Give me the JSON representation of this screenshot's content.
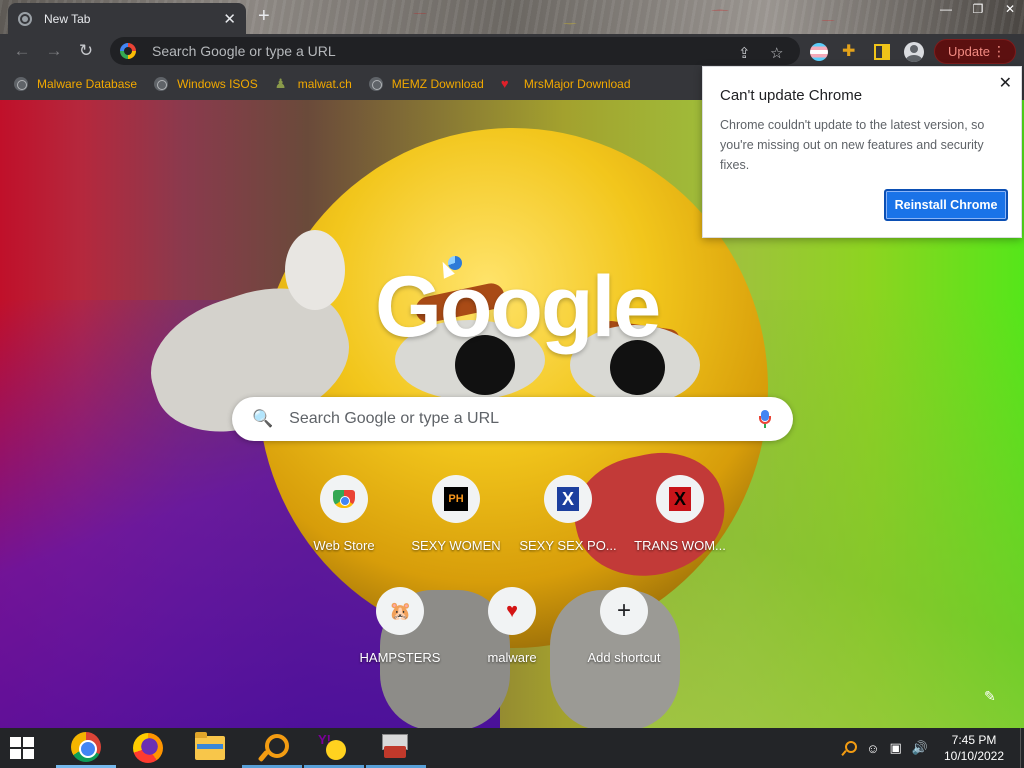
{
  "window": {
    "tab_title": "New Tab",
    "tab_close_glyph": "✕",
    "new_tab_glyph": "+",
    "controls": {
      "minimize": "—",
      "maximize": "❐",
      "close": "✕"
    }
  },
  "toolbar": {
    "back_glyph": "←",
    "forward_glyph": "→",
    "reload_glyph": "↻",
    "omnibox_placeholder": "Search Google or type a URL",
    "share_glyph": "⇪",
    "bookmark_glyph": "☆",
    "puzzle_glyph": "✚",
    "update_label": "Update",
    "menu_glyph": "⋮"
  },
  "bookmarks": [
    {
      "label": "Malware Database",
      "icon": "globe-icon"
    },
    {
      "label": "Windows ISOS",
      "icon": "globe-icon"
    },
    {
      "label": "malwat.ch",
      "icon": "person-icon"
    },
    {
      "label": "MEMZ Download",
      "icon": "globe-icon"
    },
    {
      "label": "MrsMajor Download",
      "icon": "heart-icon"
    }
  ],
  "ntp": {
    "logo_text": "Google",
    "search_placeholder": "Search Google or type a URL",
    "search_glyph": "🔍",
    "tiles": [
      {
        "label": "Web Store",
        "icon": "webstore-icon",
        "text": ""
      },
      {
        "label": "SEXY WOMEN",
        "icon": "ph-icon",
        "text": "PH"
      },
      {
        "label": "SEXY SEX PO...",
        "icon": "xvideos-icon",
        "text": "X"
      },
      {
        "label": "TRANS WOM...",
        "icon": "xvideos-red-icon",
        "text": "X"
      },
      {
        "label": "HAMPSTERS",
        "icon": "hamster-icon",
        "text": "🐹"
      },
      {
        "label": "malware",
        "icon": "heart-icon",
        "text": "♥"
      },
      {
        "label": "Add shortcut",
        "icon": "plus-icon",
        "text": "+"
      }
    ],
    "customize_glyph": "✎"
  },
  "popup": {
    "title": "Can't update Chrome",
    "body": "Chrome couldn't update to the latest version, so you're missing out on new features and security fixes.",
    "button": "Reinstall Chrome",
    "close_glyph": "✕"
  },
  "taskbar": {
    "apps": [
      "chrome-icon",
      "firefox-icon",
      "file-explorer-icon",
      "search-tool-icon",
      "yahoo-messenger-icon",
      "toolbox-icon"
    ],
    "tray": {
      "speaker_glyph": "🔊",
      "network_glyph": "▣",
      "emoji_glyph": "☺",
      "time": "7:45 PM",
      "date": "10/10/2022"
    }
  },
  "colors": {
    "chrome_dark": "#35363a",
    "omnibox": "#202124",
    "bookmark_text": "#f2a900",
    "update_red": "#5c1010",
    "accent_blue": "#1a73e8",
    "taskbar": "#232528"
  }
}
